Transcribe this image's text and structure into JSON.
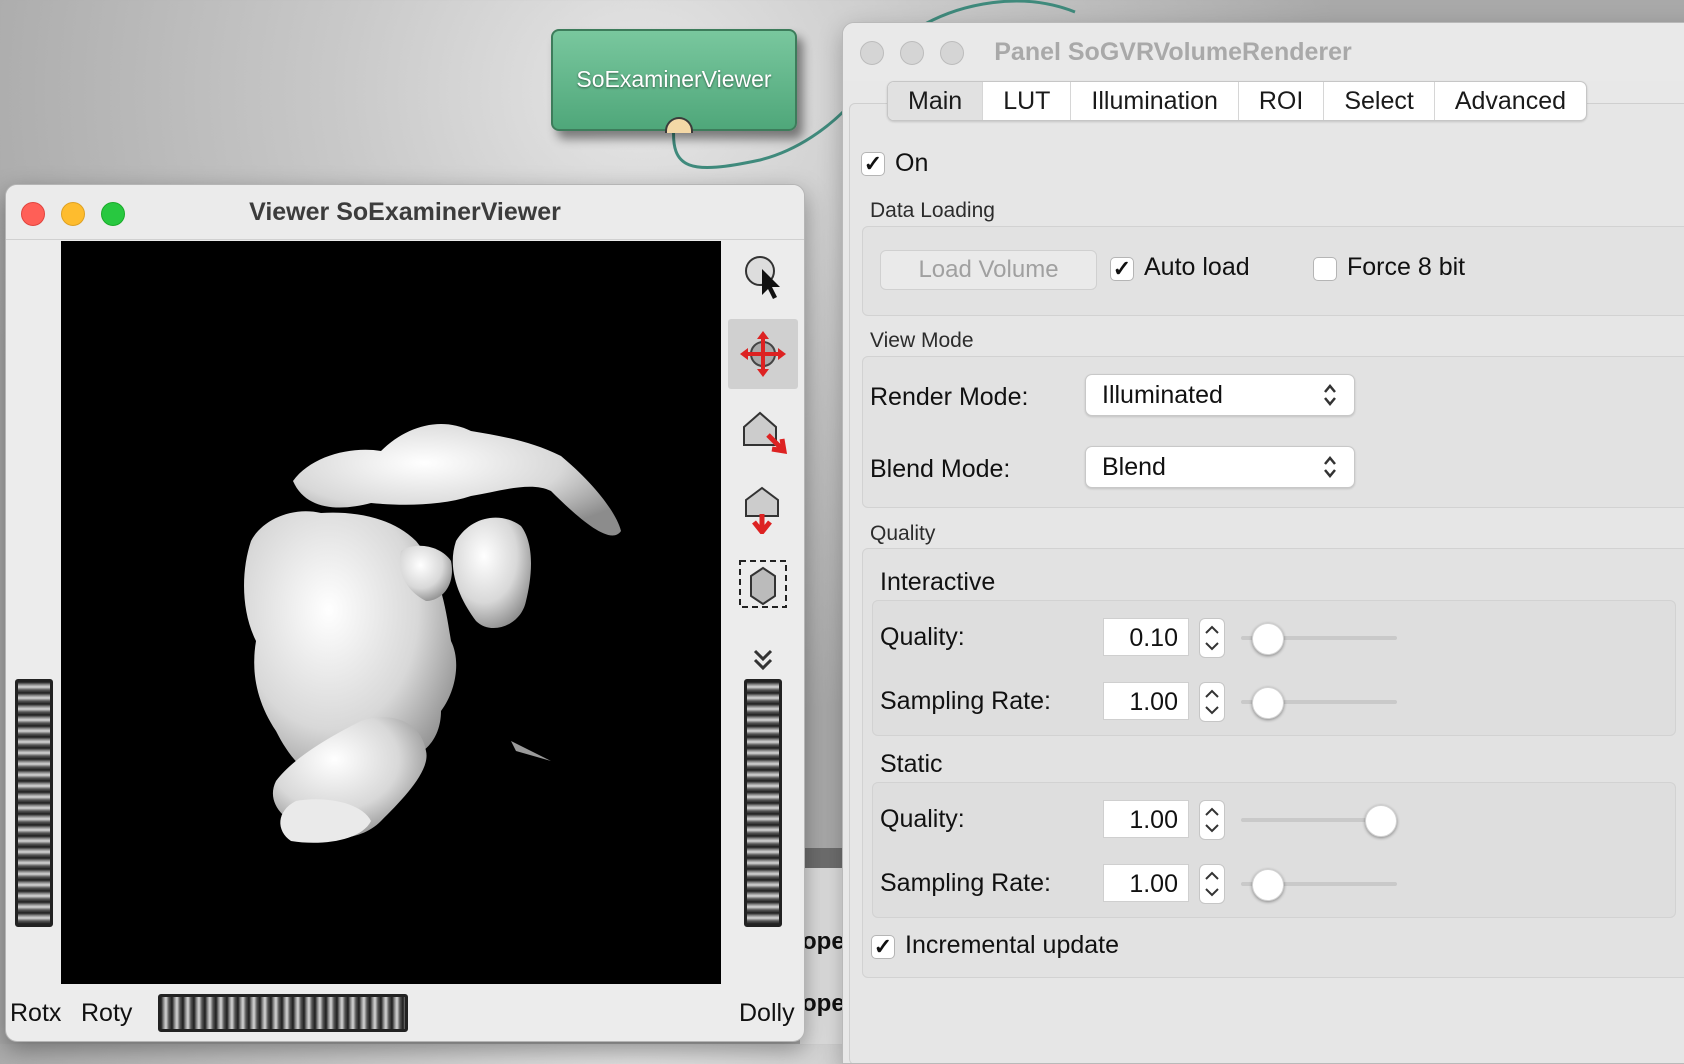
{
  "network": {
    "node_label": "SoExaminerViewer",
    "bg_text_1": "ope",
    "bg_text_2": "ope"
  },
  "viewer_window": {
    "title": "Viewer SoExaminerViewer",
    "tools": [
      "pick-icon",
      "rotate-icon",
      "home-icon",
      "set-home-icon",
      "view-all-icon",
      "more-icon"
    ],
    "labels": {
      "rotx": "Rotx",
      "roty": "Roty",
      "dolly": "Dolly"
    }
  },
  "panel_window": {
    "title": "Panel SoGVRVolumeRenderer",
    "tabs": [
      "Main",
      "LUT",
      "Illumination",
      "ROI",
      "Select",
      "Advanced"
    ],
    "active_tab": "Main",
    "on": {
      "label": "On",
      "checked": true
    },
    "data_loading": {
      "title": "Data Loading",
      "load_button": "Load Volume",
      "auto_load": {
        "label": "Auto load",
        "checked": true
      },
      "force_8bit": {
        "label": "Force 8 bit",
        "checked": false
      }
    },
    "view_mode": {
      "title": "View Mode",
      "render_mode_label": "Render Mode:",
      "render_mode_value": "Illuminated",
      "blend_mode_label": "Blend Mode:",
      "blend_mode_value": "Blend"
    },
    "quality": {
      "title": "Quality",
      "interactive": {
        "title": "Interactive",
        "quality_label": "Quality:",
        "quality_value": "0.10",
        "quality_slider": 0.1,
        "sampling_label": "Sampling Rate:",
        "sampling_value": "1.00",
        "sampling_slider": 0.1
      },
      "static": {
        "title": "Static",
        "quality_label": "Quality:",
        "quality_value": "1.00",
        "quality_slider": 1.0,
        "sampling_label": "Sampling Rate:",
        "sampling_value": "1.00",
        "sampling_slider": 0.1
      }
    },
    "incremental_update": {
      "label": "Incremental update",
      "checked": true
    }
  }
}
